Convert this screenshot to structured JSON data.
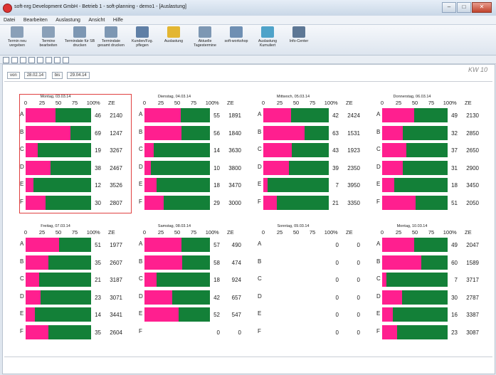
{
  "window": {
    "title": "soft-nrg Development GmbH - Betrieb 1 - soft-planning - demo1 - [Auslastung]",
    "buttons": {
      "minimize": "–",
      "maximize": "□",
      "close": "✕"
    }
  },
  "menu": [
    "Datei",
    "Bearbeiten",
    "Auslastung",
    "Ansicht",
    "Hilfe"
  ],
  "ribbon": [
    {
      "label": "Termin neu vergeben",
      "icon": "appointment-new-icon",
      "color": "#8aa0b8"
    },
    {
      "label": "Termine bearbeiten",
      "icon": "appointment-edit-icon",
      "color": "#8aa0b8"
    },
    {
      "label": "Termindate für SB drucken",
      "icon": "print-sb-icon",
      "color": "#7d97b3"
    },
    {
      "label": "Termindate gesamt drucken",
      "icon": "print-all-icon",
      "color": "#7d97b3"
    },
    {
      "label": "Kunden/Fzg. pflegen",
      "icon": "customers-vehicles-icon",
      "color": "#5f7fa6"
    },
    {
      "label": "Auslastung",
      "icon": "utilization-chart-icon",
      "color": "#e3b632"
    },
    {
      "label": "Aktuelle Tagestermine",
      "icon": "daily-appointments-icon",
      "color": "#7d97b3"
    },
    {
      "label": "soft-workshop",
      "icon": "workshop-icon",
      "color": "#6f8fb3"
    },
    {
      "label": "Auslastung Kumuliert",
      "icon": "utilization-cumulative-icon",
      "color": "#4fa3c9"
    },
    {
      "label": "Info-Center",
      "icon": "info-center-icon",
      "color": "#5d7795"
    }
  ],
  "date_range": {
    "from_label": "von",
    "from": "28.02.14",
    "to_label": "bis",
    "to": "29.04.14"
  },
  "week_label": "KW 10",
  "chart_common": {
    "ticks": [
      "0",
      "25",
      "50",
      "75",
      "100"
    ],
    "percent_header": "%",
    "ze_header": "ZE",
    "colors": {
      "booked": "#ff1f8f",
      "free": "#138038"
    }
  },
  "chart_data": [
    {
      "type": "bar",
      "title": "Montag, 03.03.14",
      "categories": [
        "A",
        "B",
        "C",
        "D",
        "E",
        "F"
      ],
      "percent": [
        46,
        69,
        19,
        38,
        12,
        30
      ],
      "ze": [
        2140,
        1247,
        3267,
        2467,
        3526,
        2807
      ],
      "has_bars": [
        true,
        true,
        true,
        true,
        true,
        true
      ],
      "xlim": [
        0,
        100
      ],
      "selected": true
    },
    {
      "type": "bar",
      "title": "Dienstag, 04.03.14",
      "categories": [
        "A",
        "B",
        "C",
        "D",
        "E",
        "F"
      ],
      "percent": [
        55,
        56,
        14,
        10,
        18,
        29
      ],
      "ze": [
        1891,
        1840,
        3630,
        3800,
        3470,
        3000
      ],
      "has_bars": [
        true,
        true,
        true,
        true,
        true,
        true
      ],
      "xlim": [
        0,
        100
      ],
      "selected": false
    },
    {
      "type": "bar",
      "title": "Mittwoch, 05.03.14",
      "categories": [
        "A",
        "B",
        "C",
        "D",
        "E",
        "F"
      ],
      "percent": [
        42,
        63,
        43,
        39,
        7,
        21
      ],
      "ze": [
        2424,
        1531,
        1923,
        2350,
        3950,
        3350
      ],
      "has_bars": [
        true,
        true,
        true,
        true,
        true,
        true
      ],
      "xlim": [
        0,
        100
      ],
      "selected": false
    },
    {
      "type": "bar",
      "title": "Donnerstag, 06.03.14",
      "categories": [
        "A",
        "B",
        "C",
        "D",
        "E",
        "F"
      ],
      "percent": [
        49,
        32,
        37,
        31,
        18,
        51
      ],
      "ze": [
        2130,
        2850,
        2650,
        2900,
        3450,
        2050
      ],
      "has_bars": [
        true,
        true,
        true,
        true,
        true,
        true
      ],
      "xlim": [
        0,
        100
      ],
      "selected": false
    },
    {
      "type": "bar",
      "title": "Freitag, 07.03.14",
      "categories": [
        "A",
        "B",
        "C",
        "D",
        "E",
        "F"
      ],
      "percent": [
        51,
        35,
        21,
        23,
        14,
        35
      ],
      "ze": [
        1977,
        2607,
        3187,
        3071,
        3441,
        2604
      ],
      "has_bars": [
        true,
        true,
        true,
        true,
        true,
        true
      ],
      "xlim": [
        0,
        100
      ],
      "selected": false
    },
    {
      "type": "bar",
      "title": "Samstag, 08.03.14",
      "categories": [
        "A",
        "B",
        "C",
        "D",
        "E",
        "F"
      ],
      "percent": [
        57,
        58,
        18,
        42,
        52,
        0
      ],
      "ze": [
        490,
        474,
        924,
        657,
        547,
        0
      ],
      "has_bars": [
        true,
        true,
        true,
        true,
        true,
        false
      ],
      "xlim": [
        0,
        100
      ],
      "selected": false
    },
    {
      "type": "bar",
      "title": "Sonntag, 09.03.14",
      "categories": [
        "A",
        "B",
        "C",
        "D",
        "E",
        "F"
      ],
      "percent": [
        0,
        0,
        0,
        0,
        0,
        0
      ],
      "ze": [
        0,
        0,
        0,
        0,
        0,
        0
      ],
      "has_bars": [
        false,
        false,
        false,
        false,
        false,
        false
      ],
      "xlim": [
        0,
        100
      ],
      "selected": false
    },
    {
      "type": "bar",
      "title": "Montag, 10.03.14",
      "categories": [
        "A",
        "B",
        "C",
        "D",
        "E",
        "F"
      ],
      "percent": [
        49,
        60,
        7,
        30,
        16,
        23
      ],
      "ze": [
        2047,
        1589,
        3717,
        2787,
        3387,
        3087
      ],
      "has_bars": [
        true,
        true,
        true,
        true,
        true,
        true
      ],
      "xlim": [
        0,
        100
      ],
      "selected": false
    }
  ]
}
